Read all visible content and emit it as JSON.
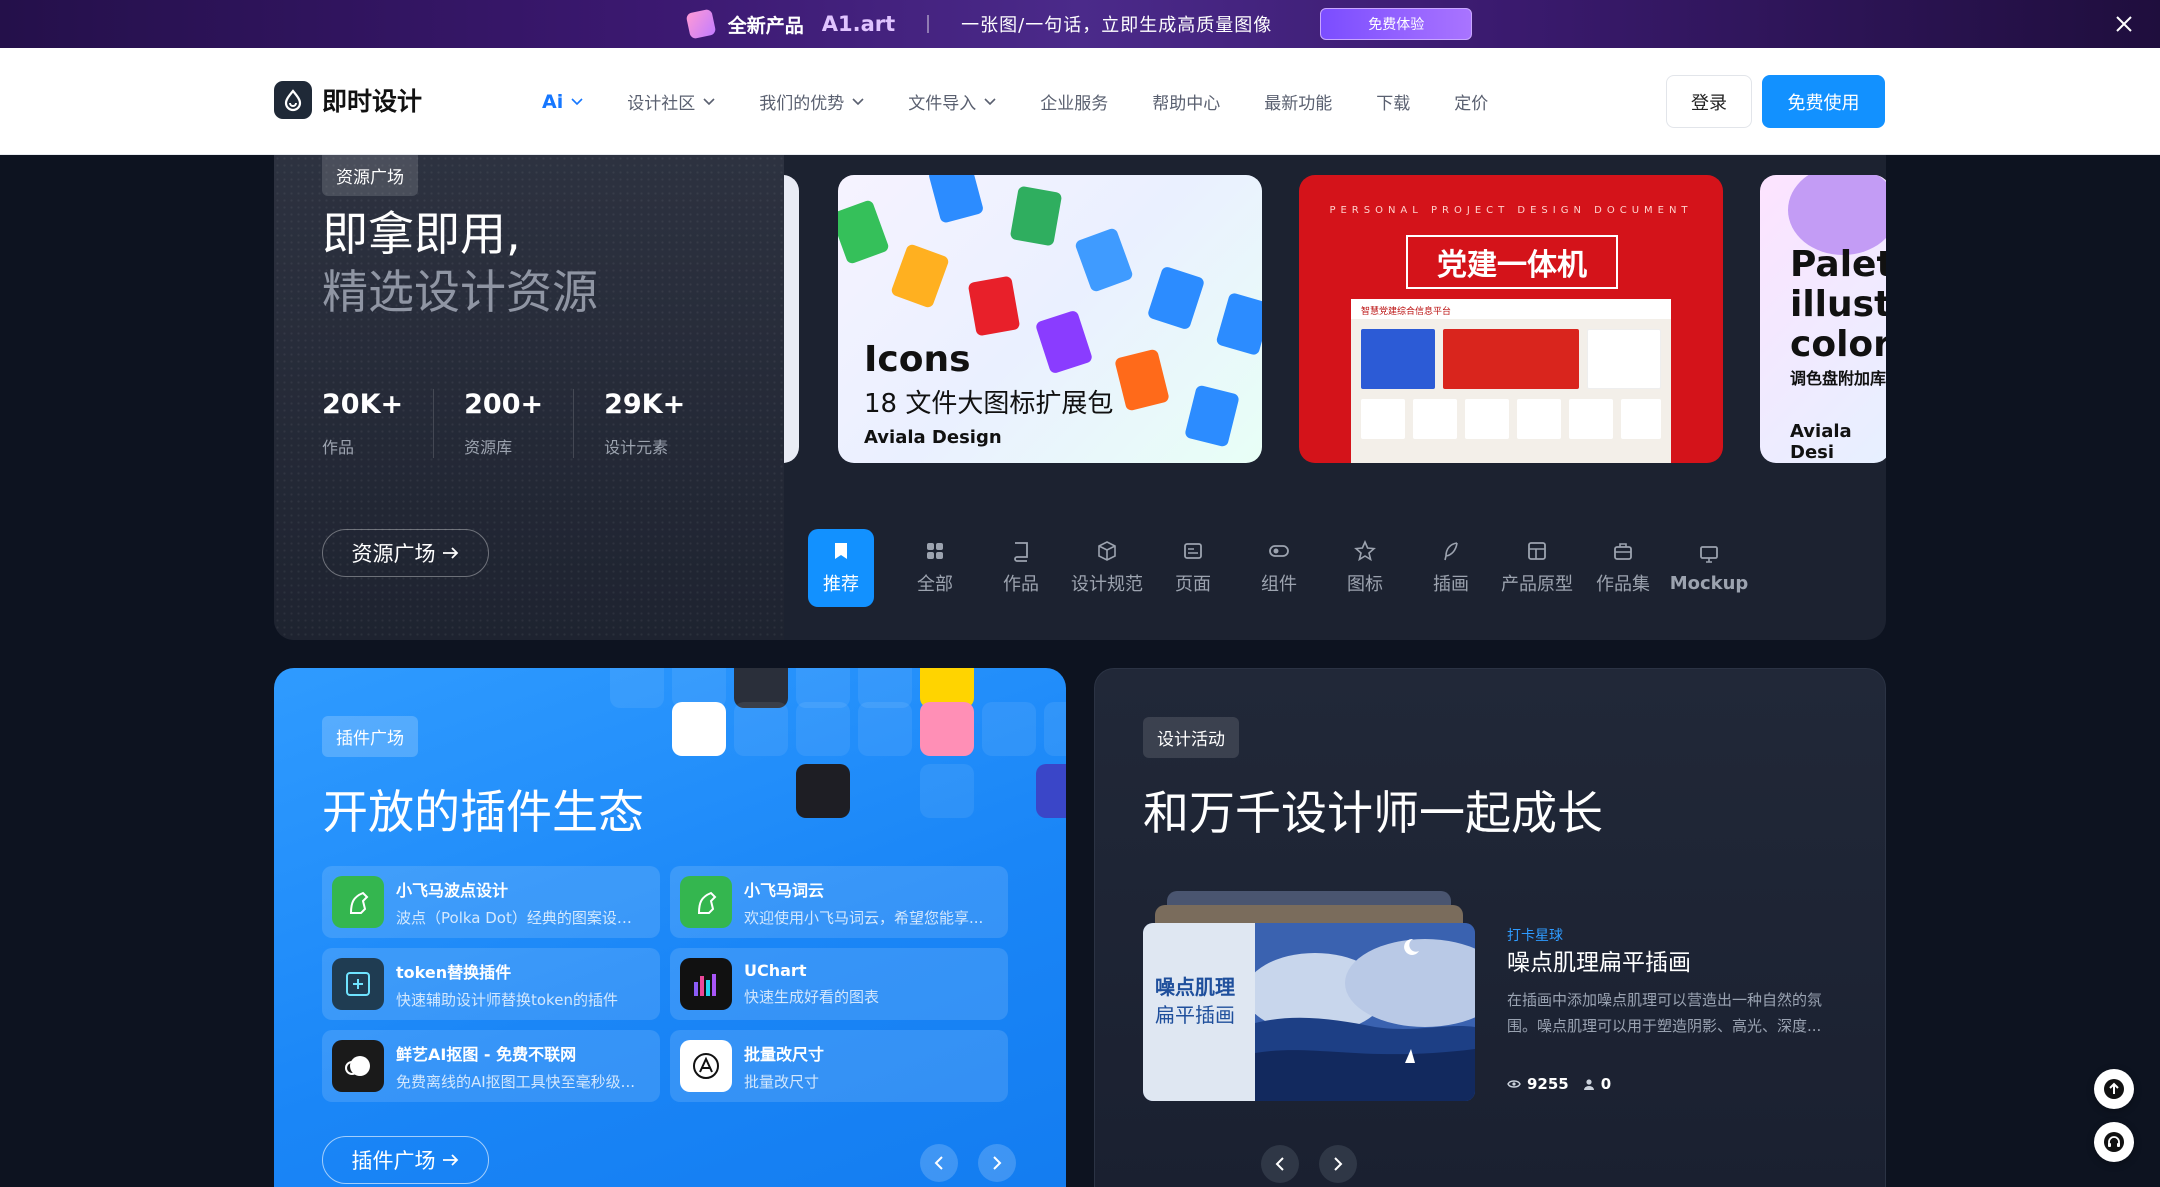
{
  "promo": {
    "label": "全新产品",
    "brand": "A1.art",
    "text": "一张图/一句话，立即生成高质量图像",
    "button": "免费体验"
  },
  "header": {
    "logo_text": "即时设计",
    "nav": [
      {
        "label": "Ai",
        "dropdown": true
      },
      {
        "label": "设计社区",
        "dropdown": true
      },
      {
        "label": "我们的优势",
        "dropdown": true
      },
      {
        "label": "文件导入",
        "dropdown": true
      },
      {
        "label": "企业服务",
        "dropdown": false
      },
      {
        "label": "帮助中心",
        "dropdown": false
      },
      {
        "label": "最新功能",
        "dropdown": false
      },
      {
        "label": "下载",
        "dropdown": false
      },
      {
        "label": "定价",
        "dropdown": false
      }
    ],
    "login": "登录",
    "free": "免费使用",
    "accent": "#1291ff"
  },
  "resources": {
    "tag": "资源广场",
    "title_line1": "即拿即用,",
    "title_line2": "精选设计资源",
    "stats": [
      {
        "value": "20K+",
        "label": "作品"
      },
      {
        "value": "200+",
        "label": "资源库"
      },
      {
        "value": "29K+",
        "label": "设计元素"
      }
    ],
    "button": "资源广场",
    "cards": {
      "icons": {
        "title": "Icons",
        "subtitle": "18 文件大图标扩展包",
        "brand": "Aviala Design"
      },
      "party": {
        "small": "PERSONAL PROJECT DESIGN DOCUMENT",
        "title": "党建一体机",
        "screen_title": "智慧党建综合信息平台"
      },
      "palette": {
        "title_l1": "Palet",
        "title_l2": "illustr",
        "title_l3": "color",
        "subtitle": "调色盘附加库",
        "brand": "Aviala Desi"
      }
    },
    "categories": [
      {
        "label": "推荐",
        "icon": "bookmark-icon",
        "active": true
      },
      {
        "label": "全部",
        "icon": "grid-icon",
        "active": false
      },
      {
        "label": "作品",
        "icon": "book-icon",
        "active": false
      },
      {
        "label": "设计规范",
        "icon": "cube-icon",
        "active": false
      },
      {
        "label": "页面",
        "icon": "page-icon",
        "active": false
      },
      {
        "label": "组件",
        "icon": "toggle-icon",
        "active": false
      },
      {
        "label": "图标",
        "icon": "star-icon",
        "active": false
      },
      {
        "label": "插画",
        "icon": "feather-icon",
        "active": false
      },
      {
        "label": "产品原型",
        "icon": "layout-icon",
        "active": false
      },
      {
        "label": "作品集",
        "icon": "briefcase-icon",
        "active": false
      },
      {
        "label": "Mockup",
        "icon": "monitor-icon",
        "active": false
      }
    ]
  },
  "plugins": {
    "tag": "插件广场",
    "title": "开放的插件生态",
    "items": [
      {
        "name": "小飞马波点设计",
        "desc": "波点（Polka Dot）经典的图案设计..."
      },
      {
        "name": "小飞马词云",
        "desc": "欢迎使用小飞马词云，希望您能享..."
      },
      {
        "name": "token替换插件",
        "desc": "快速辅助设计师替换token的插件"
      },
      {
        "name": "UChart",
        "desc": "快速生成好看的图表"
      },
      {
        "name": "鲜艺AI抠图 - 免费不联网",
        "desc": "免费离线的AI抠图工具快至毫秒级..."
      },
      {
        "name": "批量改尺寸",
        "desc": "批量改尺寸"
      }
    ],
    "button": "插件广场"
  },
  "activity": {
    "tag": "设计活动",
    "title": "和万千设计师一起成长",
    "image_text_1": "噪点肌理",
    "image_text_2": "扁平插画",
    "kicker": "打卡星球",
    "name": "噪点肌理扁平插画",
    "desc": "在插画中添加噪点肌理可以营造出一种自然的氛围。噪点肌理可以用于塑造阴影、高光、深度...",
    "views": "9255",
    "members": "0"
  }
}
